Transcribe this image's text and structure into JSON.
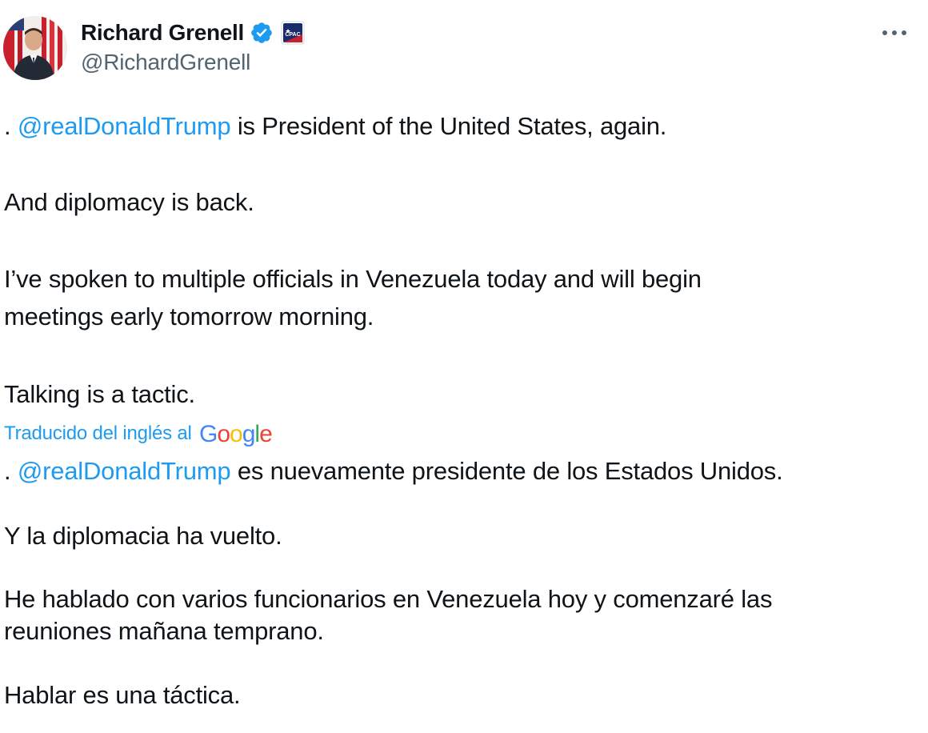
{
  "author": {
    "display_name": "Richard Grenell",
    "handle": "@RichardGrenell",
    "verified_badge_icon": "verified-badge-icon",
    "affiliation_badge_icon": "cpac-affiliation-icon",
    "affiliation_badge_label": "CPAC"
  },
  "menu": {
    "more_icon": "more-horizontal-icon"
  },
  "original": {
    "p1_prefix": ". ",
    "p1_mention": "@realDonaldTrump",
    "p1_suffix": " is President of the United States, again.",
    "p2": "And diplomacy is back.",
    "p3_line1": "I’ve spoken to multiple officials in Venezuela today and will begin",
    "p3_line2": "meetings early tomorrow morning.",
    "p4": "Talking is a tactic."
  },
  "translation": {
    "label": "Traducido del inglés al",
    "provider": "Google",
    "p1_prefix": ". ",
    "p1_mention": "@realDonaldTrump",
    "p1_suffix": " es nuevamente presidente de los Estados Unidos.",
    "p2": "Y la diplomacia ha vuelto.",
    "p3_line1": "He hablado con varios funcionarios en Venezuela hoy y comenzaré las",
    "p3_line2": "reuniones mañana temprano.",
    "p4": "Hablar es una táctica."
  },
  "colors": {
    "link": "#1d9bf0",
    "text": "#0f1419",
    "secondary": "#536471",
    "google_blue": "#4285F4",
    "google_red": "#EA4335",
    "google_yellow": "#FBBC05",
    "google_green": "#34A853"
  }
}
